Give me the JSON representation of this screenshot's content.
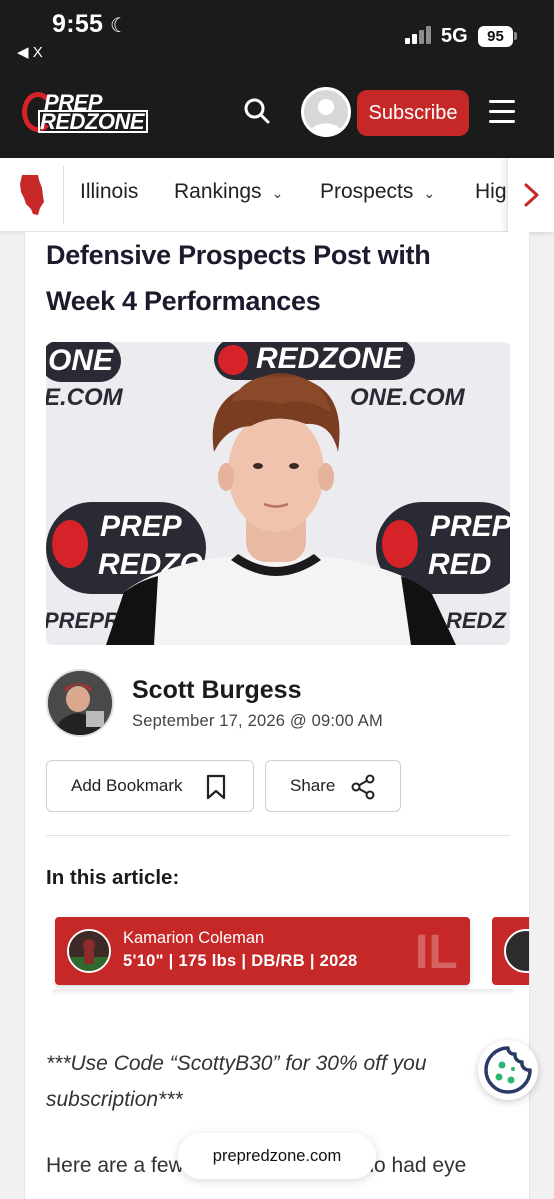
{
  "status_bar": {
    "time": "9:55",
    "back_label": "◀ X",
    "network": "5G",
    "battery": "95"
  },
  "header": {
    "logo_line1": "PREP",
    "logo_line2": "REDZONE",
    "subscribe_label": "Subscribe"
  },
  "nav": {
    "items": [
      {
        "label": "Illinois"
      },
      {
        "label": "Rankings"
      },
      {
        "label": "Prospects"
      },
      {
        "label": "Hig"
      }
    ]
  },
  "article": {
    "title_line1": "Defensive Prospects Post with",
    "title_line2": "Week 4 Performances",
    "hero_backdrop": {
      "r1a": "ONE",
      "r1b": "REDZONE",
      "r2a": "E.COM",
      "r2b": "ONE.COM",
      "b1": "PREP",
      "b2": "REDZONE",
      "b3": "PREP",
      "b4": "RED",
      "f1": "PREPR",
      "f2": "REDZ"
    },
    "author": {
      "name": "Scott Burgess",
      "date": "September 17, 2026 @ 09:00 AM"
    },
    "actions": {
      "bookmark_label": "Add Bookmark",
      "share_label": "Share"
    },
    "in_article_label": "In this article:",
    "player": {
      "name": "Kamarion Coleman",
      "info": "5'10\" | 175 lbs | DB/RB | 2028",
      "state": "IL"
    },
    "promo_line1": "***Use Code “ScottyB30” for 30% off you",
    "promo_line2": "subscription***",
    "body_line": "Here are a few of the defenders who had eye"
  },
  "browser": {
    "url": "prepredzone.com"
  },
  "colors": {
    "brand_red": "#c62828",
    "header_dark": "#1b1b1b"
  }
}
